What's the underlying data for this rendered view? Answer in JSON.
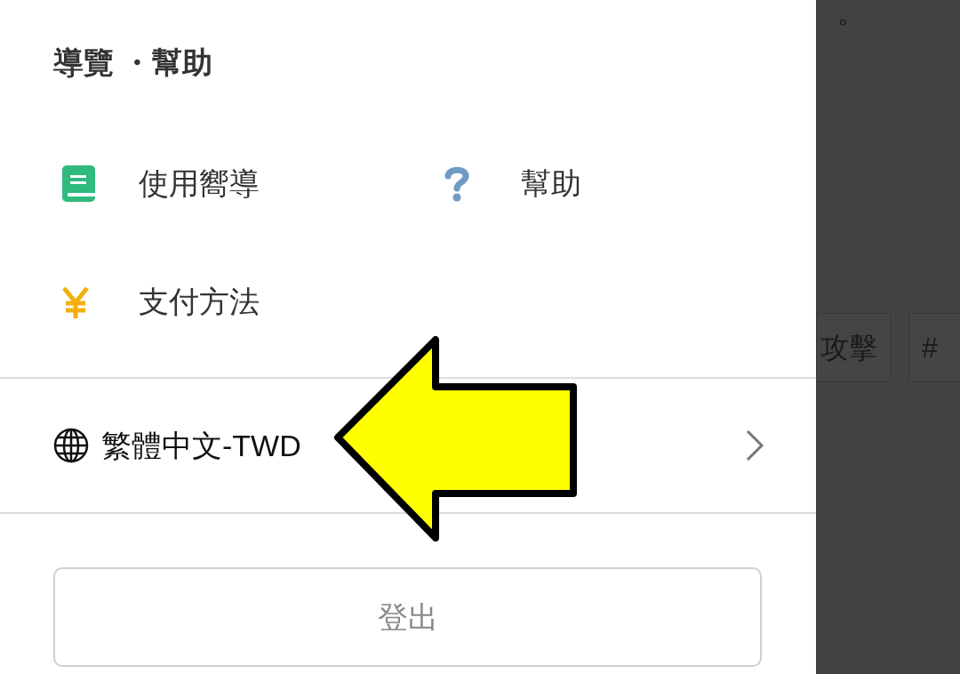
{
  "drawer": {
    "title": "導覽 ・幫助",
    "items": [
      {
        "kind": "guide",
        "label": "使用嚮導"
      },
      {
        "kind": "help",
        "label": "幫助"
      },
      {
        "kind": "payment",
        "label": "支付方法"
      }
    ],
    "language": {
      "label": "繁體中文-TWD"
    },
    "logout_button": "登出"
  },
  "background": {
    "text": "。",
    "tags": [
      "攻擊",
      "#"
    ]
  }
}
